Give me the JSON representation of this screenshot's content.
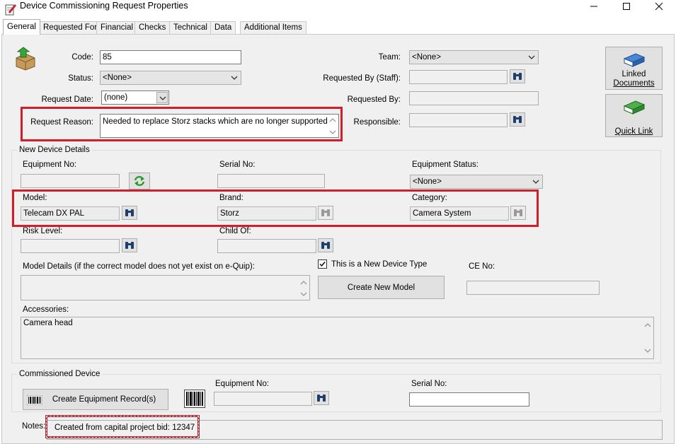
{
  "window": {
    "title": "Device Commissioning Request  Properties"
  },
  "tabs": [
    {
      "label": "General",
      "active": true
    },
    {
      "label": "Requested For",
      "active": false
    },
    {
      "label": "Financial",
      "active": false
    },
    {
      "label": "Checks",
      "active": false
    },
    {
      "label": "Technical",
      "active": false
    },
    {
      "label": "Data",
      "active": false
    },
    {
      "label": "Additional Items",
      "active": false
    }
  ],
  "request": {
    "code_label": "Code:",
    "code_value": "85",
    "status_label": "Status:",
    "status_value": "<None>",
    "request_date_label": "Request Date:",
    "request_date_value": "(none)",
    "request_reason_label": "Request Reason:",
    "request_reason_value": "Needed to replace Storz stacks which are no longer supported",
    "team_label": "Team:",
    "team_value": "<None>",
    "requested_by_staff_label": "Requested By (Staff):",
    "requested_by_staff_value": "",
    "requested_by_label": "Requested By:",
    "requested_by_value": "",
    "responsible_label": "Responsible:",
    "responsible_value": ""
  },
  "side_buttons": {
    "linked_line1": "Linked",
    "linked_line2": "Documents",
    "quick_link": "Quick Link"
  },
  "new_device": {
    "group_title": "New Device Details",
    "equipment_no_label": "Equipment No:",
    "equipment_no_value": "",
    "serial_no_label": "Serial No:",
    "serial_no_value": "",
    "equipment_status_label": "Equipment Status:",
    "equipment_status_value": "<None>",
    "model_label": "Model:",
    "model_value": "Telecam DX PAL",
    "brand_label": "Brand:",
    "brand_value": "Storz",
    "category_label": "Category:",
    "category_value": "Camera System",
    "risk_level_label": "Risk Level:",
    "risk_level_value": "",
    "child_of_label": "Child Of:",
    "child_of_value": "",
    "model_details_label": "Model Details (if the correct model does not yet exist on e-Quip):",
    "model_details_value": "",
    "new_device_type_label": "This is a New Device Type",
    "new_device_type_checked": true,
    "create_new_model_label": "Create New Model",
    "ce_no_label": "CE No:",
    "ce_no_value": "",
    "accessories_label": "Accessories:",
    "accessories_value": "Camera head"
  },
  "commissioned": {
    "group_title": "Commissioned Device",
    "create_record_label": "Create Equipment Record(s)",
    "equipment_no_label": "Equipment No:",
    "equipment_no_value": "",
    "serial_no_label": "Serial No:",
    "serial_no_value": ""
  },
  "notes": {
    "label": "Notes:",
    "value": "Created from capital project bid: 12347"
  },
  "colors": {
    "highlight_red": "#d21d2b",
    "panel_bg": "#f0f0f0"
  },
  "icons": {
    "app": "pencil-document-icon",
    "record": "open-box-arrow-icon",
    "binoculars": "binoculars-icon",
    "refresh": "green-refresh-icon",
    "linked_documents": "blue-book-icon",
    "quick_link": "green-book-icon",
    "barcode": "barcode-icon"
  }
}
